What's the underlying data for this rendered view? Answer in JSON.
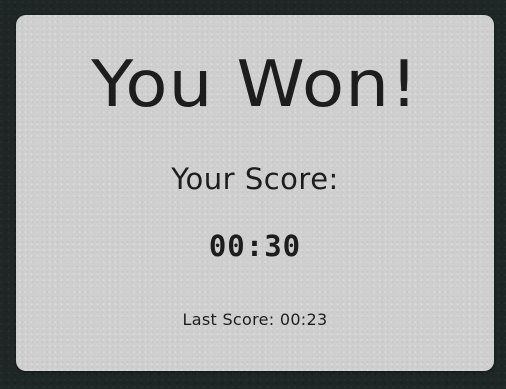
{
  "win_screen": {
    "title": "You Won!",
    "score_label": "Your Score:",
    "score_value": "00:30",
    "last_score": "Last Score: 00:23"
  },
  "colors": {
    "background": "#1e2726",
    "panel": "#cfcfcf",
    "text": "#1d1d1d"
  }
}
